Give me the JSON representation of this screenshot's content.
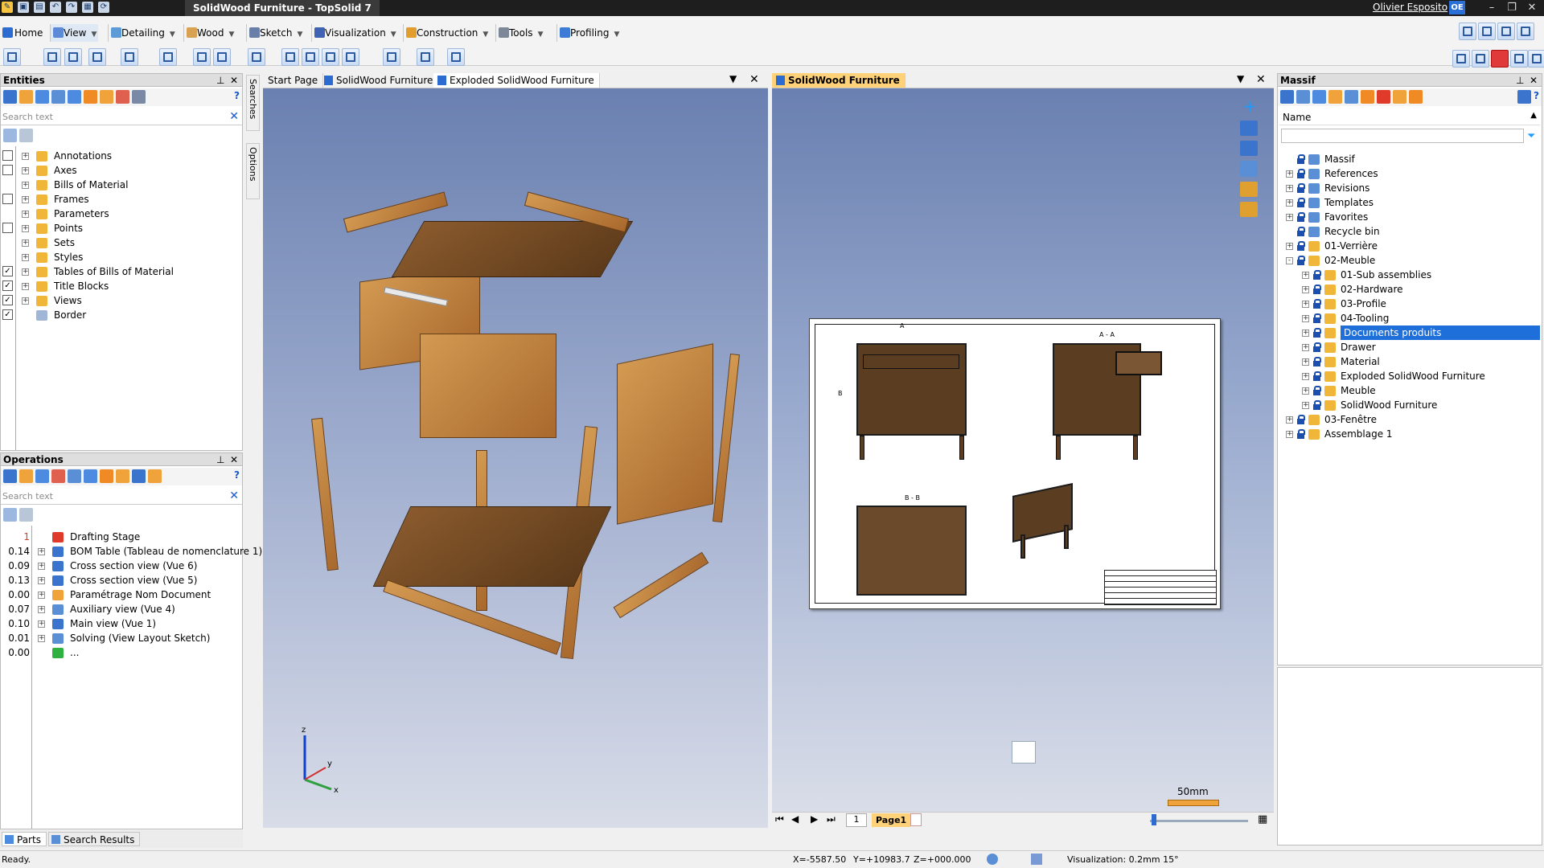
{
  "window": {
    "title": "SolidWood Furniture - TopSolid 7",
    "user": "Olivier Esposito",
    "user_initials": "OE"
  },
  "ribbon": {
    "tabs": [
      "Home",
      "View",
      "Detailing",
      "Wood",
      "Sketch",
      "Visualization",
      "Construction",
      "Tools",
      "Profiling"
    ]
  },
  "entities": {
    "title": "Entities",
    "search_placeholder": "Search text",
    "items": [
      {
        "label": "Annotations",
        "checked": false
      },
      {
        "label": "Axes",
        "checked": false
      },
      {
        "label": "Bills of Material",
        "checked": null
      },
      {
        "label": "Frames",
        "checked": false
      },
      {
        "label": "Parameters",
        "checked": null
      },
      {
        "label": "Points",
        "checked": false
      },
      {
        "label": "Sets",
        "checked": null
      },
      {
        "label": "Styles",
        "checked": null
      },
      {
        "label": "Tables of Bills of Material",
        "checked": true
      },
      {
        "label": "Title Blocks",
        "checked": true
      },
      {
        "label": "Views",
        "checked": true
      },
      {
        "label": "Border",
        "checked": true
      }
    ]
  },
  "operations": {
    "title": "Operations",
    "search_placeholder": "Search text",
    "items": [
      {
        "time": "1",
        "label": "Drafting Stage"
      },
      {
        "time": "0.14",
        "label": "BOM Table (Tableau de nomenclature 1)"
      },
      {
        "time": "0.09",
        "label": "Cross section view (Vue 6)"
      },
      {
        "time": "0.13",
        "label": "Cross section view (Vue 5)"
      },
      {
        "time": "0.00",
        "label": "Paramétrage Nom Document"
      },
      {
        "time": "0.07",
        "label": "Auxiliary view (Vue 4)"
      },
      {
        "time": "0.10",
        "label": "Main view (Vue 1)"
      },
      {
        "time": "0.01",
        "label": "Solving (View Layout Sketch)"
      },
      {
        "time": "0.00",
        "label": "..."
      }
    ]
  },
  "side_tabs": [
    "Searches",
    "Options"
  ],
  "left_doc": {
    "tabs": [
      "Start Page",
      "SolidWood Furniture",
      "Exploded SolidWood Furniture"
    ],
    "axes": [
      "z",
      "y",
      "x"
    ]
  },
  "right_doc": {
    "tab": "SolidWood Furniture",
    "page_number": "1",
    "page_tab": "Page1",
    "scale_label": "50mm",
    "section_labels": [
      "A",
      "A - A",
      "B",
      "B - B"
    ]
  },
  "massif": {
    "title": "Massif",
    "column": "Name",
    "items": [
      {
        "label": "Massif",
        "level": 0,
        "expander": ""
      },
      {
        "label": "References",
        "level": 0,
        "expander": "+"
      },
      {
        "label": "Revisions",
        "level": 0,
        "expander": "+"
      },
      {
        "label": "Templates",
        "level": 0,
        "expander": "+"
      },
      {
        "label": "Favorites",
        "level": 0,
        "expander": "+"
      },
      {
        "label": "Recycle bin",
        "level": 0,
        "expander": ""
      },
      {
        "label": "01-Verrière",
        "level": 0,
        "expander": "+"
      },
      {
        "label": "02-Meuble",
        "level": 0,
        "expander": "-"
      },
      {
        "label": "01-Sub assemblies",
        "level": 1,
        "expander": "+"
      },
      {
        "label": "02-Hardware",
        "level": 1,
        "expander": "+"
      },
      {
        "label": "03-Profile",
        "level": 1,
        "expander": "+"
      },
      {
        "label": "04-Tooling",
        "level": 1,
        "expander": "+"
      },
      {
        "label": "Documents produits",
        "level": 1,
        "expander": "+",
        "selected": true
      },
      {
        "label": "Drawer",
        "level": 1,
        "expander": "+"
      },
      {
        "label": "Material",
        "level": 1,
        "expander": "+"
      },
      {
        "label": "Exploded SolidWood Furniture",
        "level": 1,
        "expander": "+"
      },
      {
        "label": "Meuble",
        "level": 1,
        "expander": "+"
      },
      {
        "label": "SolidWood Furniture",
        "level": 1,
        "expander": "+"
      },
      {
        "label": "03-Fenêtre",
        "level": 0,
        "expander": "+"
      },
      {
        "label": "Assemblage 1",
        "level": 0,
        "expander": "+"
      }
    ]
  },
  "bottom_tabs": [
    "Parts",
    "Search Results"
  ],
  "status": {
    "message": "Ready.",
    "x": "X=-5587.50",
    "y": "Y=+10983.7",
    "z": "Z=+000.000",
    "visualization": "Visualization: 0.2mm 15°"
  },
  "colors": {
    "accent": "#ffd27a",
    "selection": "#1e6fd9",
    "titlebar": "#1e1e1e"
  }
}
